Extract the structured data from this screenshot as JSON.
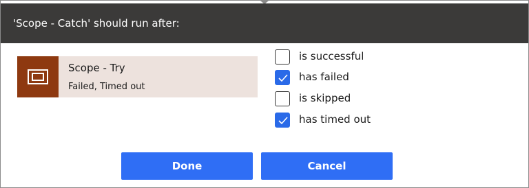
{
  "dialog": {
    "title": "'Scope - Catch' should run after:"
  },
  "action": {
    "name": "Scope - Try",
    "status": "Failed, Timed out",
    "icon": "scope-icon",
    "icon_bg_color": "#8e3910",
    "card_bg_color": "#ede2dd"
  },
  "options": [
    {
      "label": "is successful",
      "checked": false
    },
    {
      "label": "has failed",
      "checked": true
    },
    {
      "label": "is skipped",
      "checked": false
    },
    {
      "label": "has timed out",
      "checked": true
    }
  ],
  "buttons": {
    "done_label": "Done",
    "cancel_label": "Cancel",
    "color": "#2f6ef5"
  }
}
